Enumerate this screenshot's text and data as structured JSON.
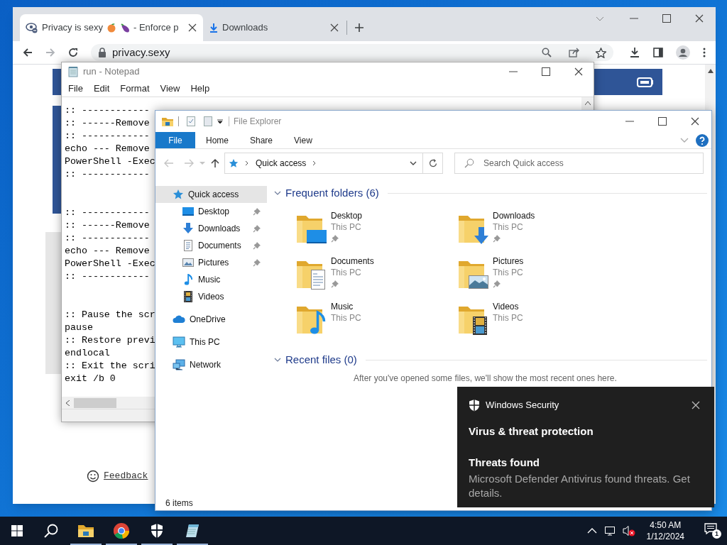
{
  "browser": {
    "tabs": [
      {
        "kind": "site",
        "title": "Privacy is sexy",
        "title_suffix": "- Enforce p",
        "selected": true
      },
      {
        "kind": "downloads",
        "title": "Downloads",
        "selected": false
      }
    ],
    "address": "privacy.sexy",
    "page": {
      "feedback_link": "Feedback"
    }
  },
  "notepad": {
    "title": "run - Notepad",
    "menu": [
      "File",
      "Edit",
      "Format",
      "View",
      "Help"
    ],
    "blocks": [
      [
        ":: ------------",
        ":: ------Remove",
        ":: ------------",
        "echo --- Remove",
        "PowerShell -Exec",
        ":: ------------"
      ],
      [
        ":: ------------",
        ":: ------Remove",
        ":: ------------",
        "echo --- Remove",
        "PowerShell -Exec",
        ":: ------------"
      ],
      [
        ":: Pause the scr",
        "pause",
        ":: Restore previ",
        "endlocal",
        ":: Exit the scri",
        "exit /b 0"
      ]
    ]
  },
  "explorer": {
    "title": "File Explorer",
    "ribbon_tabs": [
      {
        "kind": "file",
        "label": "File"
      },
      {
        "kind": "tab",
        "label": "Home"
      },
      {
        "kind": "tab",
        "label": "Share"
      },
      {
        "kind": "tab",
        "label": "View"
      }
    ],
    "path": "Quick access",
    "search_placeholder": "Search Quick access",
    "sidebar": [
      {
        "kind": "star",
        "label": "Quick access",
        "selected": true,
        "children": [
          {
            "kind": "desktop",
            "label": "Desktop",
            "pinned": true,
            "selected": false
          },
          {
            "kind": "downloads",
            "label": "Downloads",
            "pinned": true,
            "selected": false
          },
          {
            "kind": "documents",
            "label": "Documents",
            "pinned": true,
            "selected": false
          },
          {
            "kind": "pictures",
            "label": "Pictures",
            "pinned": true,
            "selected": false
          },
          {
            "kind": "music",
            "label": "Music",
            "pinned": false,
            "selected": false
          },
          {
            "kind": "videos",
            "label": "Videos",
            "pinned": false,
            "selected": false
          }
        ]
      },
      {
        "kind": "cloud",
        "label": "OneDrive",
        "selected": false
      },
      {
        "kind": "pc",
        "label": "This PC",
        "selected": false
      },
      {
        "kind": "network",
        "label": "Network",
        "selected": false
      }
    ],
    "groups": [
      {
        "title": "Frequent folders (6)",
        "expanded": true,
        "items": [
          {
            "kind": "desktop",
            "name": "Desktop",
            "location": "This PC",
            "pinned": true
          },
          {
            "kind": "downloads",
            "name": "Downloads",
            "location": "This PC",
            "pinned": true
          },
          {
            "kind": "documents",
            "name": "Documents",
            "location": "This PC",
            "pinned": true
          },
          {
            "kind": "pictures",
            "name": "Pictures",
            "location": "This PC",
            "pinned": true
          },
          {
            "kind": "music",
            "name": "Music",
            "location": "This PC",
            "pinned": false
          },
          {
            "kind": "videos",
            "name": "Videos",
            "location": "This PC",
            "pinned": false
          }
        ]
      },
      {
        "title": "Recent files (0)",
        "expanded": true,
        "message": "After you've opened some files, we'll show the most recent ones here."
      }
    ],
    "status_bar": "6 items"
  },
  "toast": {
    "app": "Windows Security",
    "heading": "Virus & threat protection",
    "title": "Threats found",
    "body": "Microsoft Defender Antivirus found threats. Get details."
  },
  "taskbar": {
    "apps": [
      {
        "kind": "explorer",
        "running": true
      },
      {
        "kind": "browser",
        "running": true
      },
      {
        "kind": "shield",
        "running": true
      },
      {
        "kind": "notepad",
        "running": true
      }
    ],
    "time": "4:50 AM",
    "date": "1/12/2024",
    "notifications": "1"
  }
}
